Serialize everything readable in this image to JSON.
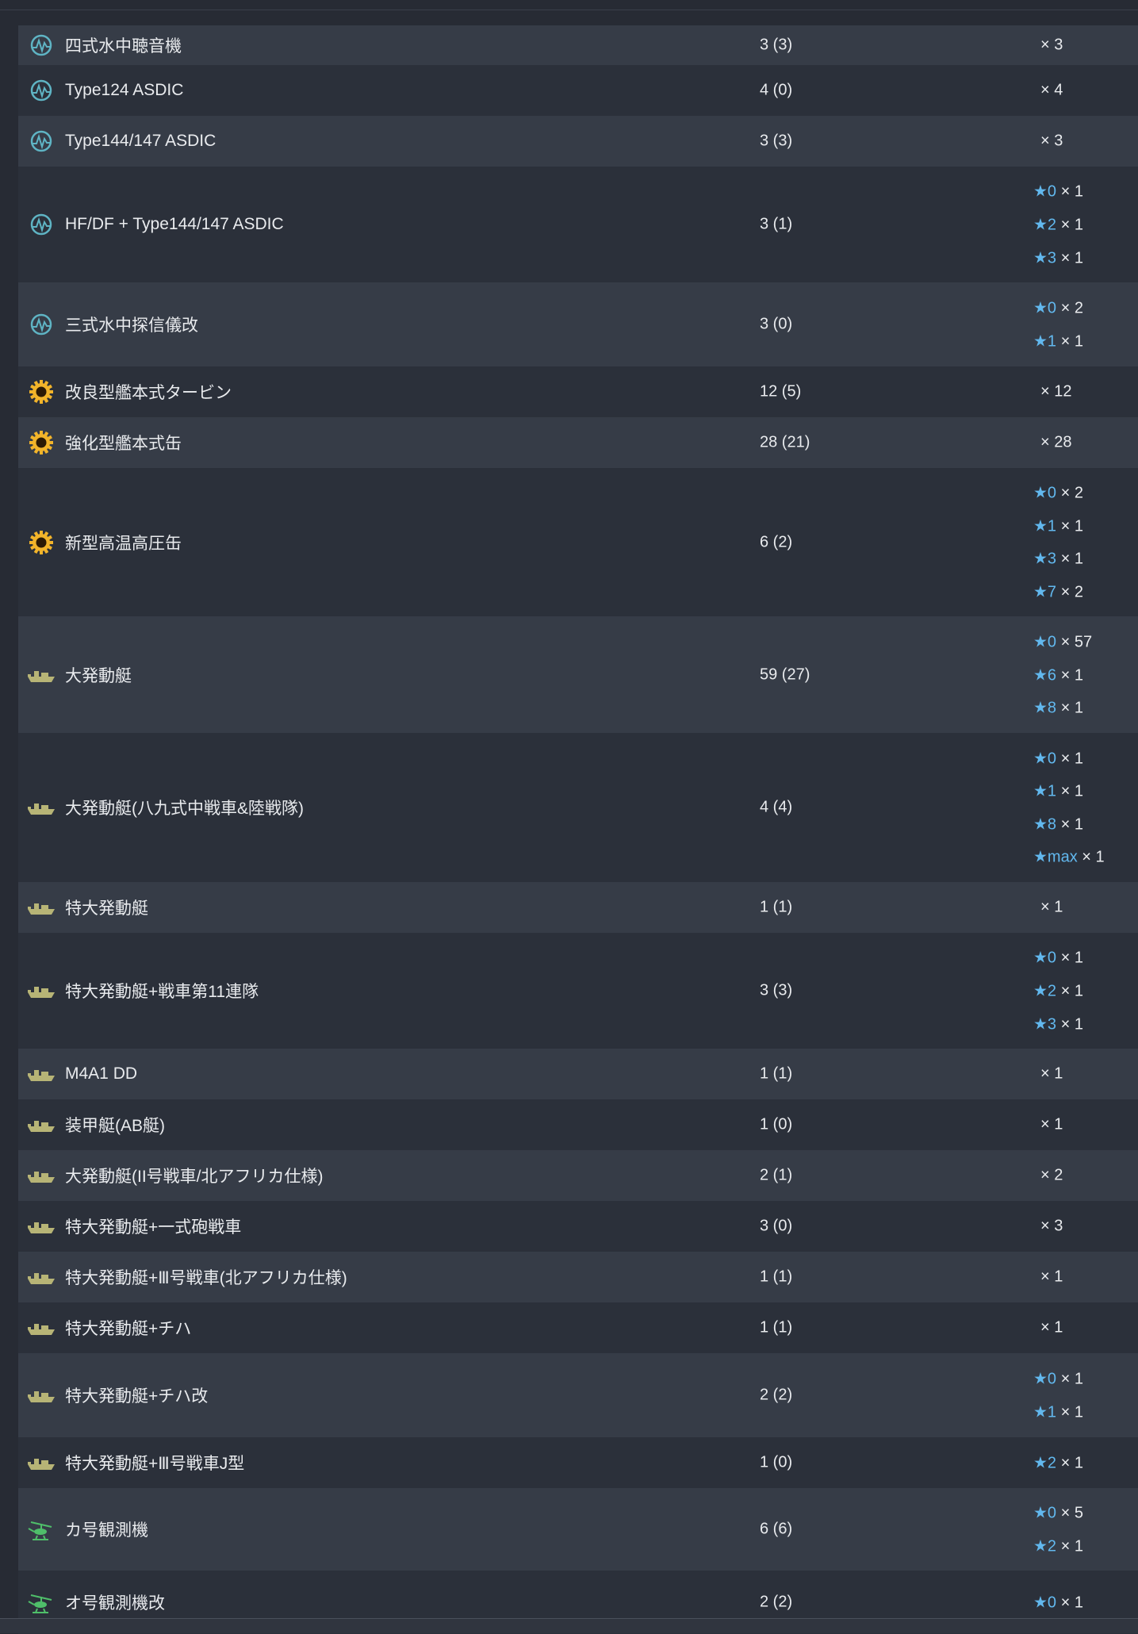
{
  "colors": {
    "background": "#272b34",
    "row_odd": "#363c47",
    "row_even": "#2b303a",
    "text": "#e9ebee",
    "star": "#62b8ee",
    "sonar_icon": "#5fb4c4",
    "engine_icon": "#f2b42a",
    "landing_craft_icon": "#b7b476",
    "autogyro_icon": "#4fbf6a"
  },
  "rows": [
    {
      "icon": "sonar-icon",
      "name": "四式水中聴音機",
      "count": "3 (3)",
      "mult": "× 3",
      "stars": []
    },
    {
      "icon": "sonar-icon",
      "name": "Type124 ASDIC",
      "count": "4 (0)",
      "mult": "× 4",
      "stars": []
    },
    {
      "icon": "sonar-icon",
      "name": "Type144/147 ASDIC",
      "count": "3 (3)",
      "mult": "× 3",
      "stars": []
    },
    {
      "icon": "sonar-icon",
      "name": "HF/DF + Type144/147 ASDIC",
      "count": "3 (1)",
      "mult": "",
      "stars": [
        {
          "lvl": "★0",
          "mult": "× 1"
        },
        {
          "lvl": "★2",
          "mult": "× 1"
        },
        {
          "lvl": "★3",
          "mult": "× 1"
        }
      ]
    },
    {
      "icon": "sonar-icon",
      "name": "三式水中探信儀改",
      "count": "3 (0)",
      "mult": "",
      "stars": [
        {
          "lvl": "★0",
          "mult": "× 2"
        },
        {
          "lvl": "★1",
          "mult": "× 1"
        }
      ]
    },
    {
      "icon": "engine-icon",
      "name": "改良型艦本式タービン",
      "count": "12 (5)",
      "mult": "× 12",
      "stars": []
    },
    {
      "icon": "engine-icon",
      "name": "強化型艦本式缶",
      "count": "28 (21)",
      "mult": "× 28",
      "stars": []
    },
    {
      "icon": "engine-icon",
      "name": "新型高温高圧缶",
      "count": "6 (2)",
      "mult": "",
      "stars": [
        {
          "lvl": "★0",
          "mult": "× 2"
        },
        {
          "lvl": "★1",
          "mult": "× 1"
        },
        {
          "lvl": "★3",
          "mult": "× 1"
        },
        {
          "lvl": "★7",
          "mult": "× 2"
        }
      ]
    },
    {
      "icon": "landing-craft-icon",
      "name": "大発動艇",
      "count": "59 (27)",
      "mult": "",
      "stars": [
        {
          "lvl": "★0",
          "mult": "× 57"
        },
        {
          "lvl": "★6",
          "mult": "× 1"
        },
        {
          "lvl": "★8",
          "mult": "× 1"
        }
      ]
    },
    {
      "icon": "landing-craft-icon",
      "name": "大発動艇(八九式中戦車&陸戦隊)",
      "count": "4 (4)",
      "mult": "",
      "stars": [
        {
          "lvl": "★0",
          "mult": "× 1"
        },
        {
          "lvl": "★1",
          "mult": "× 1"
        },
        {
          "lvl": "★8",
          "mult": "× 1"
        },
        {
          "lvl": "★max",
          "mult": "× 1"
        }
      ]
    },
    {
      "icon": "landing-craft-icon",
      "name": "特大発動艇",
      "count": "1 (1)",
      "mult": "× 1",
      "stars": []
    },
    {
      "icon": "landing-craft-icon",
      "name": "特大発動艇+戦車第11連隊",
      "count": "3 (3)",
      "mult": "",
      "stars": [
        {
          "lvl": "★0",
          "mult": "× 1"
        },
        {
          "lvl": "★2",
          "mult": "× 1"
        },
        {
          "lvl": "★3",
          "mult": "× 1"
        }
      ]
    },
    {
      "icon": "landing-craft-icon",
      "name": "M4A1 DD",
      "count": "1 (1)",
      "mult": "× 1",
      "stars": []
    },
    {
      "icon": "landing-craft-icon",
      "name": "装甲艇(AB艇)",
      "count": "1 (0)",
      "mult": "× 1",
      "stars": []
    },
    {
      "icon": "landing-craft-icon",
      "name": "大発動艇(II号戦車/北アフリカ仕様)",
      "count": "2 (1)",
      "mult": "× 2",
      "stars": []
    },
    {
      "icon": "landing-craft-icon",
      "name": "特大発動艇+一式砲戦車",
      "count": "3 (0)",
      "mult": "× 3",
      "stars": []
    },
    {
      "icon": "landing-craft-icon",
      "name": "特大発動艇+Ⅲ号戦車(北アフリカ仕様)",
      "count": "1 (1)",
      "mult": "× 1",
      "stars": []
    },
    {
      "icon": "landing-craft-icon",
      "name": "特大発動艇+チハ",
      "count": "1 (1)",
      "mult": "× 1",
      "stars": []
    },
    {
      "icon": "landing-craft-icon",
      "name": "特大発動艇+チハ改",
      "count": "2 (2)",
      "mult": "",
      "stars": [
        {
          "lvl": "★0",
          "mult": "× 1"
        },
        {
          "lvl": "★1",
          "mult": "× 1"
        }
      ]
    },
    {
      "icon": "landing-craft-icon",
      "name": "特大発動艇+Ⅲ号戦車J型",
      "count": "1 (0)",
      "mult": "",
      "stars": [
        {
          "lvl": "★2",
          "mult": "× 1"
        }
      ]
    },
    {
      "icon": "autogyro-icon",
      "name": "カ号観測機",
      "count": "6 (6)",
      "mult": "",
      "stars": [
        {
          "lvl": "★0",
          "mult": "× 5"
        },
        {
          "lvl": "★2",
          "mult": "× 1"
        }
      ]
    },
    {
      "icon": "autogyro-icon",
      "name": "オ号観測機改",
      "count": "2 (2)",
      "mult": "",
      "stars": [
        {
          "lvl": "★0",
          "mult": "× 1"
        }
      ]
    }
  ]
}
